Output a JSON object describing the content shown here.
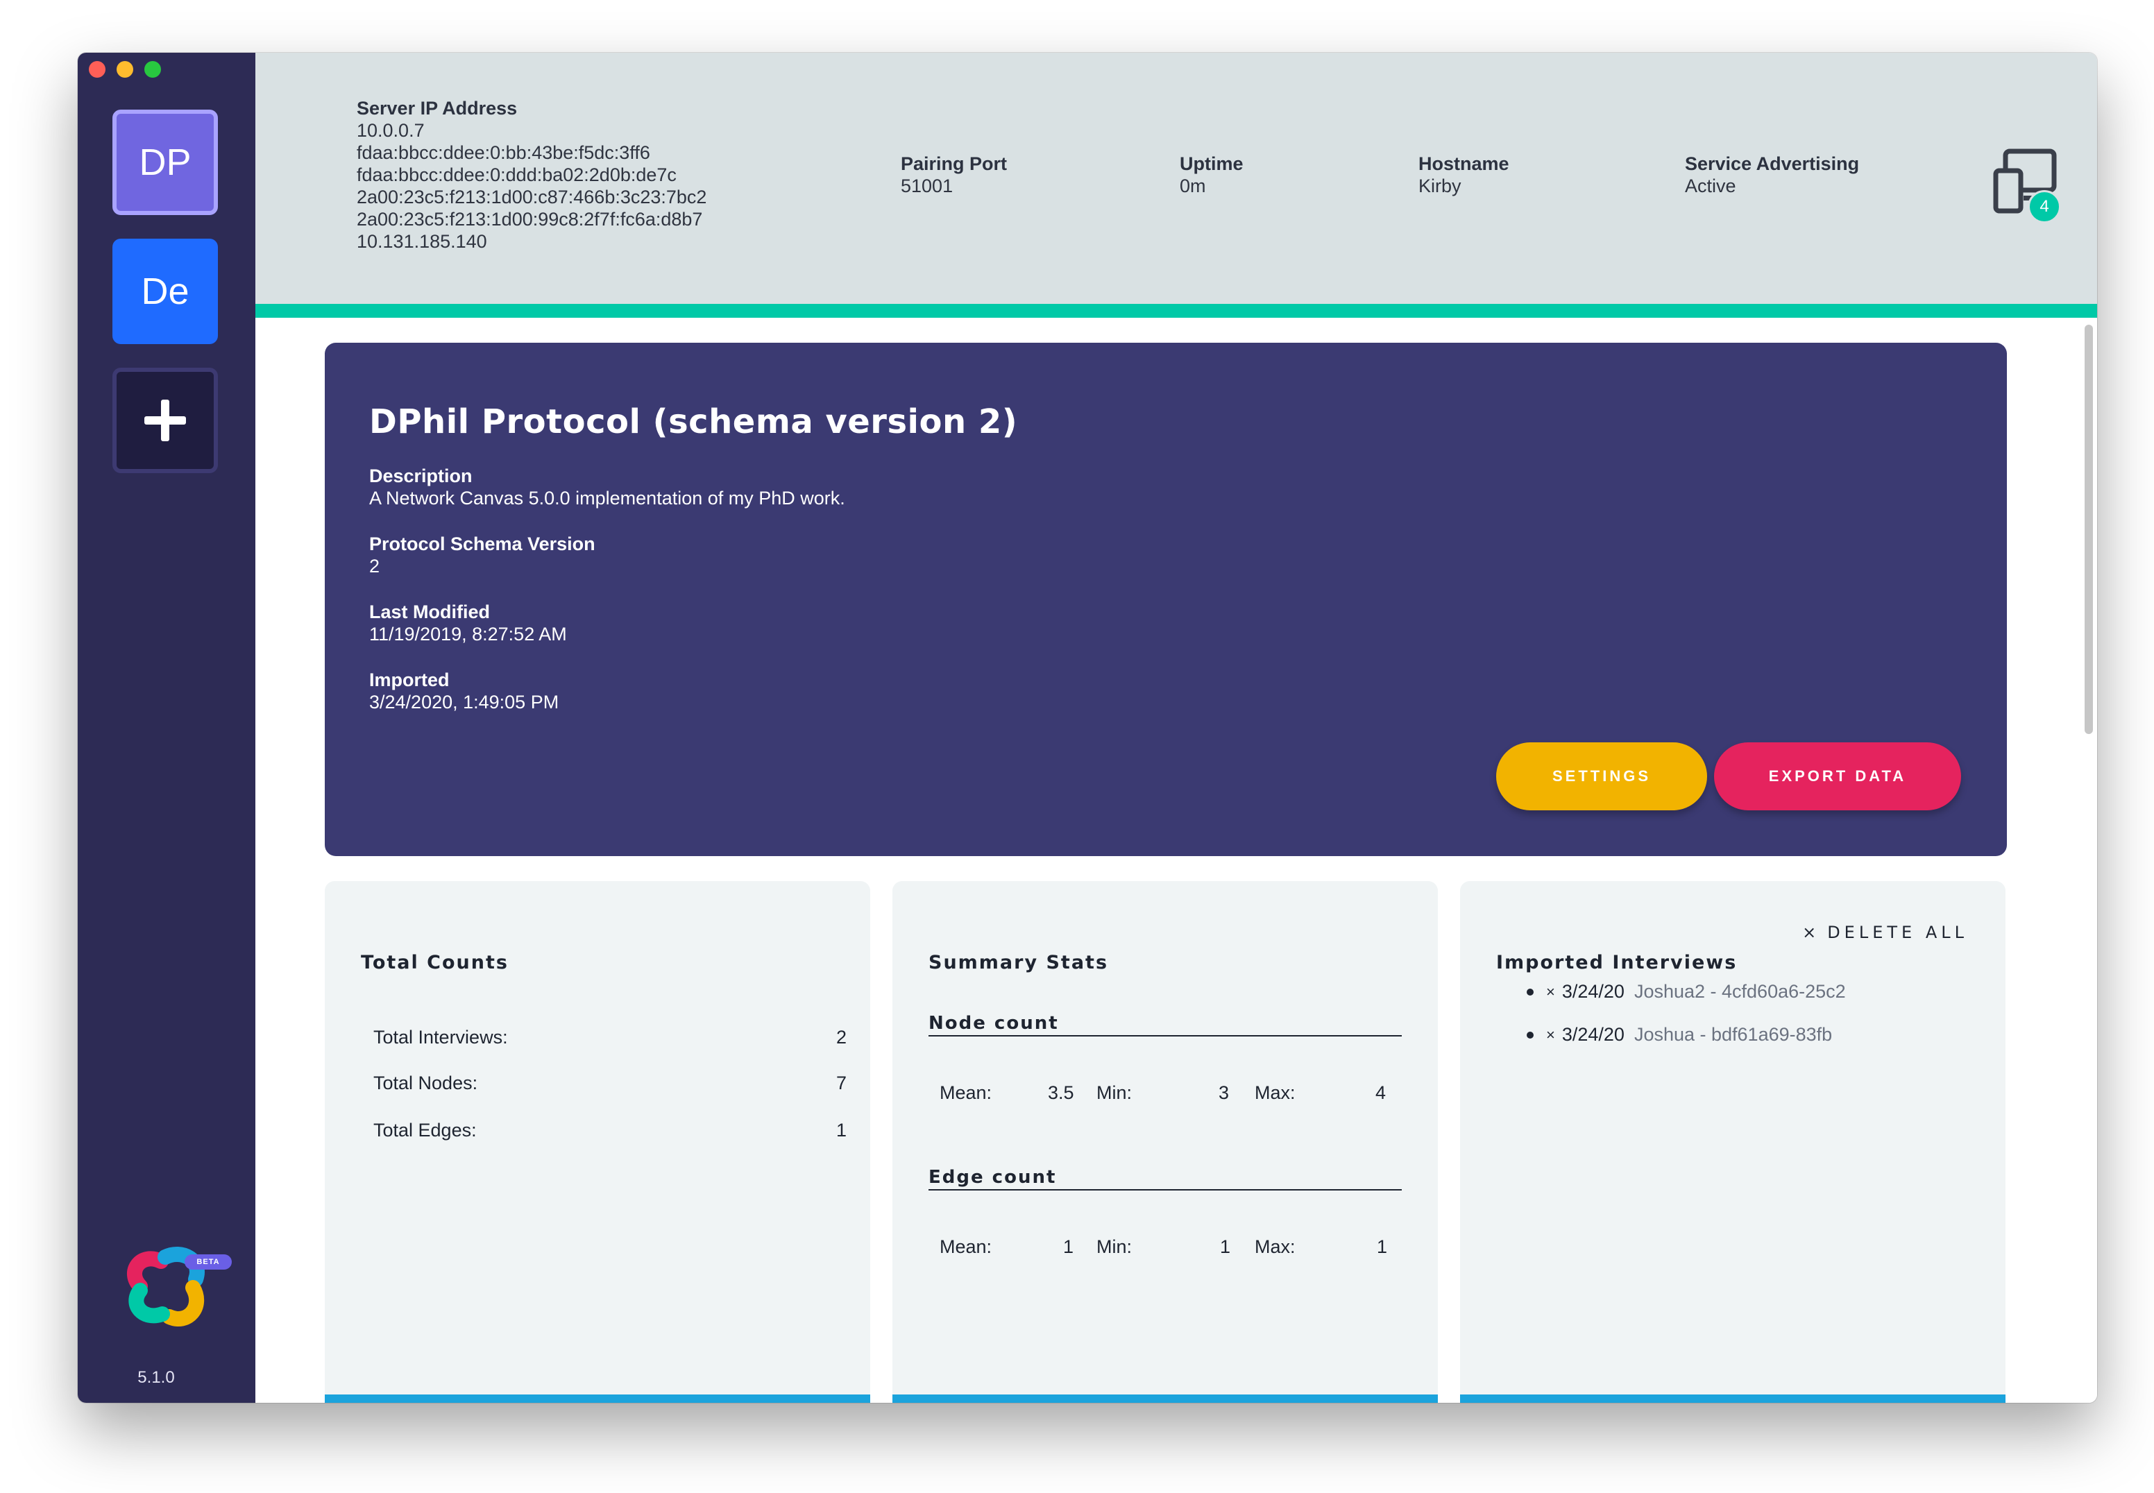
{
  "sidebar": {
    "tiles": [
      {
        "label": "DP"
      },
      {
        "label": "De"
      }
    ],
    "add_icon": "plus-icon",
    "logo_icon": "network-canvas-logo",
    "beta_label": "BETA",
    "version": "5.1.0"
  },
  "header": {
    "server_ip": {
      "label": "Server IP Address",
      "values": [
        "10.0.0.7",
        "fdaa:bbcc:ddee:0:bb:43be:f5dc:3ff6",
        "fdaa:bbcc:ddee:0:ddd:ba02:2d0b:de7c",
        "2a00:23c5:f213:1d00:c87:466b:3c23:7bc2",
        "2a00:23c5:f213:1d00:99c8:2f7f:fc6a:d8b7",
        "10.131.185.140"
      ]
    },
    "pairing_port": {
      "label": "Pairing Port",
      "value": "51001"
    },
    "uptime": {
      "label": "Uptime",
      "value": "0m"
    },
    "hostname": {
      "label": "Hostname",
      "value": "Kirby"
    },
    "service_advertising": {
      "label": "Service Advertising",
      "value": "Active"
    },
    "devices": {
      "icon": "devices-icon",
      "count": "4"
    },
    "accent_color": "#00c9a7"
  },
  "protocol": {
    "title": "DPhil Protocol (schema version 2)",
    "fields": [
      {
        "label": "Description",
        "value": "A Network Canvas 5.0.0 implementation of my PhD work."
      },
      {
        "label": "Protocol Schema Version",
        "value": "2"
      },
      {
        "label": "Last Modified",
        "value": "11/19/2019, 8:27:52 AM"
      },
      {
        "label": "Imported",
        "value": "3/24/2020, 1:49:05 PM"
      }
    ],
    "settings_label": "SETTINGS",
    "export_label": "EXPORT DATA",
    "settings_color": "#f2b300",
    "export_color": "#e5235e"
  },
  "total_counts": {
    "title": "Total Counts",
    "rows": [
      {
        "label": "Total Interviews:",
        "value": "2"
      },
      {
        "label": "Total Nodes:",
        "value": "7"
      },
      {
        "label": "Total Edges:",
        "value": "1"
      }
    ]
  },
  "summary_stats": {
    "title": "Summary Stats",
    "node": {
      "title": "Node count",
      "mean_label": "Mean:",
      "mean": "3.5",
      "min_label": "Min:",
      "min": "3",
      "max_label": "Max:",
      "max": "4"
    },
    "edge": {
      "title": "Edge count",
      "mean_label": "Mean:",
      "mean": "1",
      "min_label": "Min:",
      "min": "1",
      "max_label": "Max:",
      "max": "1"
    }
  },
  "imported_interviews": {
    "title": "Imported Interviews",
    "delete_all_label": "DELETE ALL",
    "items": [
      {
        "date": "3/24/20",
        "name": "Joshua2 - 4cfd60a6-25c2"
      },
      {
        "date": "3/24/20",
        "name": "Joshua - bdf61a69-83fb"
      }
    ]
  }
}
